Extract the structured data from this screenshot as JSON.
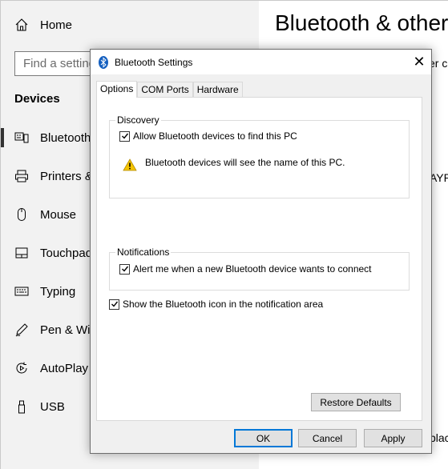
{
  "settings": {
    "home_label": "Home",
    "search_placeholder": "Find a setting",
    "section_label": "Devices",
    "nav_items": [
      {
        "label": "Bluetooth & other devices",
        "icon": "keyboard-phone-icon",
        "active": true
      },
      {
        "label": "Printers & scanners",
        "icon": "printer-icon",
        "active": false
      },
      {
        "label": "Mouse",
        "icon": "mouse-icon",
        "active": false
      },
      {
        "label": "Touchpad",
        "icon": "touchpad-icon",
        "active": false
      },
      {
        "label": "Typing",
        "icon": "keyboard-icon",
        "active": false
      },
      {
        "label": "Pen & Windows Ink",
        "icon": "pen-icon",
        "active": false
      },
      {
        "label": "AutoPlay",
        "icon": "autoplay-icon",
        "active": false
      },
      {
        "label": "USB",
        "icon": "usb-icon",
        "active": false
      }
    ],
    "content_title": "Bluetooth & other devices",
    "content_fragments": [
      "er c",
      "AYPC",
      "blac"
    ]
  },
  "dialog": {
    "title": "Bluetooth Settings",
    "close_label": "✕",
    "tabs": [
      "Options",
      "COM Ports",
      "Hardware"
    ],
    "active_tab": "Options",
    "discovery": {
      "legend": "Discovery",
      "allow_label": "Allow Bluetooth devices to find this PC",
      "allow_checked": true,
      "warning_text": "Bluetooth devices will see the name of this PC."
    },
    "notifications": {
      "legend": "Notifications",
      "alert_label": "Alert me when a new Bluetooth device wants to connect",
      "alert_checked": true
    },
    "show_icon_label": "Show the Bluetooth icon in the notification area",
    "show_icon_checked": true,
    "restore_defaults_label": "Restore Defaults",
    "ok_label": "OK",
    "cancel_label": "Cancel",
    "apply_label": "Apply"
  },
  "colors": {
    "accent": "#0078d7",
    "nav_background": "#f2f2f2",
    "dialog_background": "#f0f0f0",
    "warning_yellow": "#f5c400"
  }
}
